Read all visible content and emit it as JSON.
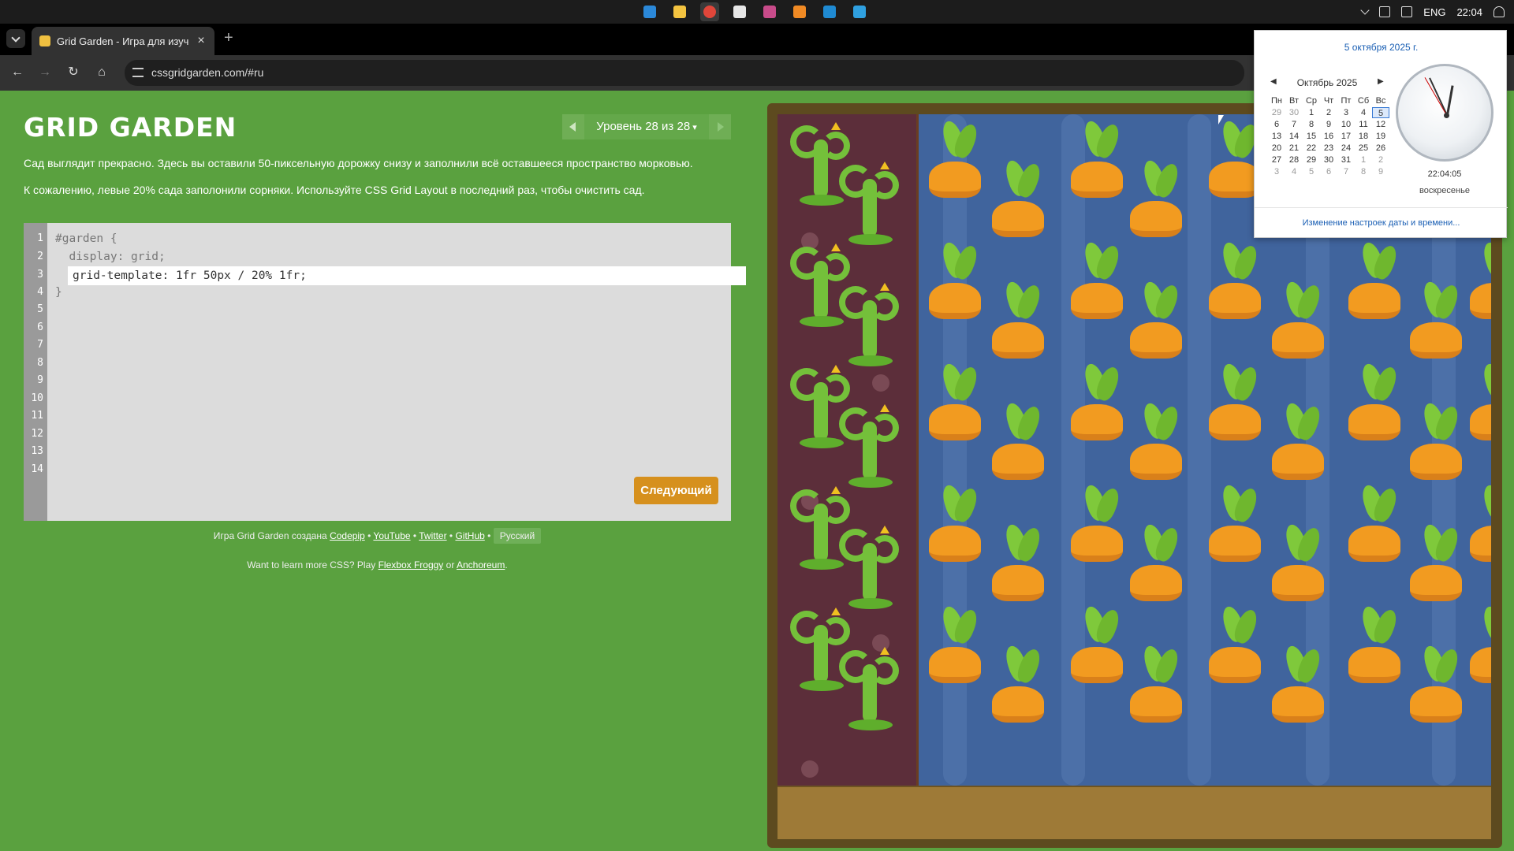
{
  "taskbar": {
    "apps": [
      "start-icon",
      "file-explorer-icon",
      "chrome-icon",
      "shield-app-icon",
      "grid-app-icon",
      "sublime-icon",
      "vscode-icon",
      "photo-app-icon"
    ],
    "language": "ENG",
    "time": "22:04"
  },
  "browser": {
    "tab_title": "Grid Garden - Игра для изучения CSS Grid",
    "url": "cssgridgarden.com/#ru"
  },
  "page": {
    "logo": "GRID GARDEN",
    "level_label": "Уровень 28 из 28",
    "instruction_1": "Сад выглядит прекрасно. Здесь вы оставили 50-пиксельную дорожку снизу и заполнили всё оставшееся пространство морковью.",
    "instruction_2": "К сожалению, левые 20% сада заполонили сорняки. Используйте CSS Grid Layout в последний раз, чтобы очистить сад.",
    "line_numbers": [
      "1",
      "2",
      "3",
      "4",
      "5",
      "6",
      "7",
      "8",
      "9",
      "10",
      "11",
      "12",
      "13",
      "14"
    ],
    "code_line_1": "#garden {",
    "code_line_2": "  display: grid;",
    "code_input_value": "grid-template: 1fr 50px / 20% 1fr;",
    "code_line_4": "}",
    "next_button": "Следующий",
    "credits_prefix": "Игра Grid Garden создана",
    "credits_codepip": "Codepip",
    "credits_youtube": "YouTube",
    "credits_twitter": "Twitter",
    "credits_github": "GitHub",
    "credits_language": "Русский",
    "learn_prefix": "Want to learn more CSS? Play",
    "learn_froggy": "Flexbox Froggy",
    "learn_or": "or",
    "learn_anchoreum": "Anchoreum",
    "learn_suffix": "."
  },
  "calendar": {
    "date_link": "5 октября 2025 г.",
    "month": "Октябрь 2025",
    "weekdays": [
      "Пн",
      "Вт",
      "Ср",
      "Чт",
      "Пт",
      "Сб",
      "Вс"
    ],
    "days": [
      [
        "29",
        "30",
        "1",
        "2",
        "3",
        "4",
        "5"
      ],
      [
        "6",
        "7",
        "8",
        "9",
        "10",
        "11",
        "12"
      ],
      [
        "13",
        "14",
        "15",
        "16",
        "17",
        "18",
        "19"
      ],
      [
        "20",
        "21",
        "22",
        "23",
        "24",
        "25",
        "26"
      ],
      [
        "27",
        "28",
        "29",
        "30",
        "31",
        "1",
        "2"
      ],
      [
        "3",
        "4",
        "5",
        "6",
        "7",
        "8",
        "9"
      ]
    ],
    "clock_time": "22:04:05",
    "weekday_name": "воскресенье",
    "settings_link": "Изменение настроек даты и времени..."
  },
  "colors": {
    "page_bg": "#5aa13f",
    "button_accent": "#d6901d",
    "garden_water": "#40649d",
    "weeds_soil": "#5c2e3a"
  }
}
